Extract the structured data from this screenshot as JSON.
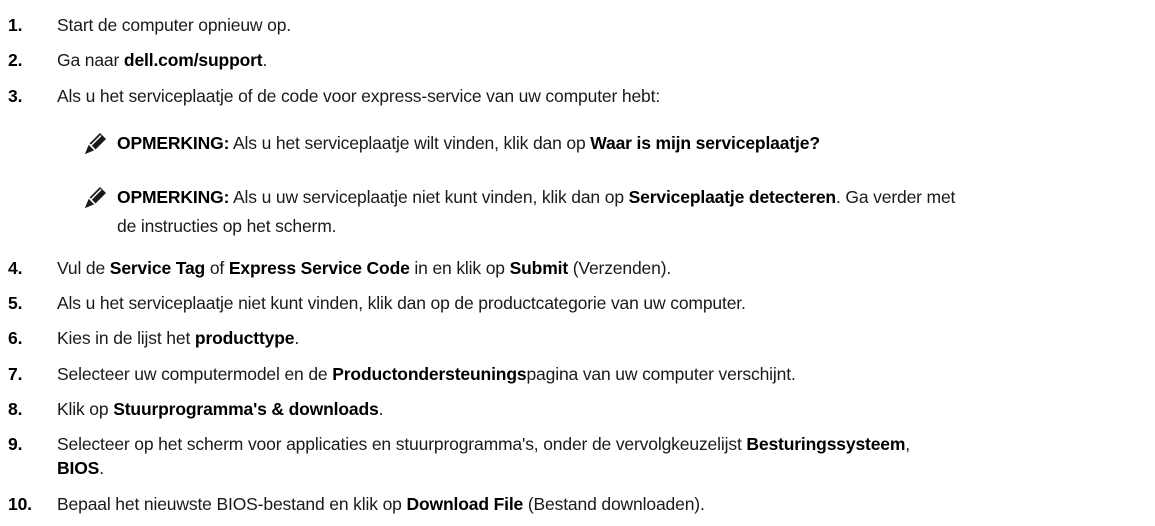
{
  "steps": [
    {
      "n": "1.",
      "parts": [
        {
          "t": "Start de computer opnieuw op.",
          "b": false
        }
      ]
    },
    {
      "n": "2.",
      "parts": [
        {
          "t": "Ga naar ",
          "b": false
        },
        {
          "t": "dell.com/support",
          "b": true
        },
        {
          "t": ".",
          "b": false
        }
      ]
    },
    {
      "n": "3.",
      "parts": [
        {
          "t": "Als u het serviceplaatje of de code voor express-service van uw computer hebt:",
          "b": false
        }
      ]
    },
    {
      "n": "4.",
      "parts": [
        {
          "t": "Vul de ",
          "b": false
        },
        {
          "t": "Service Tag",
          "b": true
        },
        {
          "t": " of ",
          "b": false
        },
        {
          "t": "Express Service Code",
          "b": true
        },
        {
          "t": " in en klik op ",
          "b": false
        },
        {
          "t": "Submit",
          "b": true
        },
        {
          "t": " (Verzenden).",
          "b": false
        }
      ]
    },
    {
      "n": "5.",
      "parts": [
        {
          "t": "Als u het serviceplaatje niet kunt vinden, klik dan op de productcategorie van uw computer.",
          "b": false
        }
      ]
    },
    {
      "n": "6.",
      "parts": [
        {
          "t": "Kies in de lijst het ",
          "b": false
        },
        {
          "t": "producttype",
          "b": true
        },
        {
          "t": ".",
          "b": false
        }
      ]
    },
    {
      "n": "7.",
      "parts": [
        {
          "t": "Selecteer uw computermodel en de ",
          "b": false
        },
        {
          "t": "Productondersteunings",
          "b": true
        },
        {
          "t": "pagina van uw computer verschijnt.",
          "b": false
        }
      ]
    },
    {
      "n": "8.",
      "parts": [
        {
          "t": "Klik op ",
          "b": false
        },
        {
          "t": "Stuurprogramma's & downloads",
          "b": true
        },
        {
          "t": ".",
          "b": false
        }
      ]
    },
    {
      "n": "9.",
      "parts": [
        {
          "t": "Selecteer op het scherm voor applicaties en stuurprogramma's, onder de vervolgkeuzelijst ",
          "b": false
        },
        {
          "t": "Besturingssysteem",
          "b": true
        },
        {
          "t": ",",
          "b": false
        }
      ]
    },
    {
      "n": "",
      "parts": [
        {
          "t": "BIOS",
          "b": true
        },
        {
          "t": ".",
          "b": false
        }
      ]
    },
    {
      "n": "10.",
      "parts": [
        {
          "t": "Bepaal het nieuwste BIOS-bestand en klik op ",
          "b": false
        },
        {
          "t": "Download File",
          "b": true
        },
        {
          "t": " (Bestand downloaden).",
          "b": false
        }
      ]
    }
  ],
  "notes": [
    {
      "icon": "pencil-note-icon",
      "lines": [
        [
          {
            "t": "OPMERKING:",
            "b": true
          },
          {
            "t": " Als u het serviceplaatje wilt vinden, klik dan op ",
            "b": false
          },
          {
            "t": "Waar is mijn serviceplaatje?",
            "b": true
          }
        ]
      ]
    },
    {
      "icon": "pencil-note-icon",
      "lines": [
        [
          {
            "t": "OPMERKING:",
            "b": true
          },
          {
            "t": " Als u uw serviceplaatje niet kunt vinden, klik dan op ",
            "b": false
          },
          {
            "t": "Serviceplaatje detecteren",
            "b": true
          },
          {
            "t": ". Ga verder met",
            "b": false
          }
        ],
        [
          {
            "t": "de instructies op het scherm.",
            "b": false
          }
        ]
      ]
    }
  ]
}
